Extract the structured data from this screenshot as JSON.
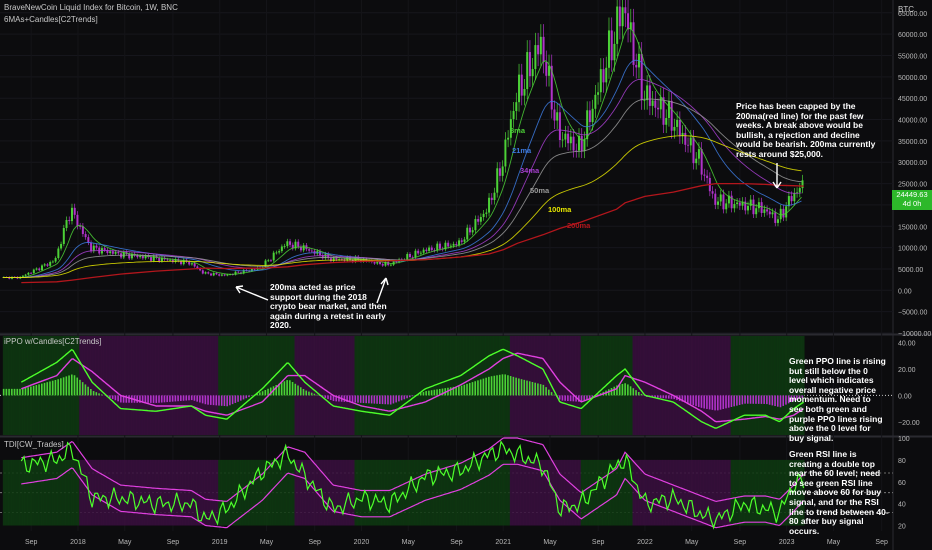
{
  "header": {
    "symbol_line": "BraveNewCoin Liquid Index for Bitcoin, 1W, BNC",
    "indicator_line": "6MAs+Candles[C2Trends]",
    "currency": "BTC"
  },
  "panels": {
    "ppo_title": "iPPO w/Candles[C2Trends]",
    "tdi_title": "TDI[CW_Trades]"
  },
  "price_tag": {
    "value": "24449.63",
    "sub": "4d 0h"
  },
  "annotations": {
    "top_right": "Price has been capped by the 200ma(red line) for the past few weeks.  A break above would be bullish, a rejection and decline would be bearish.  200ma currently rests around $25,000.",
    "support": "200ma acted as price support during the 2018 crypto bear market, and then again during a retest in early 2020.",
    "ppo_note": "Green PPO line is rising but still below the 0 level which indicates overall negative price momentum.  Need to see both green and purple PPO lines rising above the 0 level for buy signal.",
    "tdi_note": "Green RSI line is creating a double top near the 60 level; need to see green RSI line move above 60 for buy signal, and for the RSI line to trend between 40-80 after buy signal occurs."
  },
  "ma_labels": [
    "8ma",
    "21ma",
    "34ma",
    "50ma",
    "100ma",
    "200ma"
  ],
  "colors": {
    "background": "#0c0c0e",
    "bull": "#4cd137",
    "bear": "#b033c9",
    "ma8": "#4cd137",
    "ma21": "#3d7be0",
    "ma34": "#a83fd1",
    "ma50": "#9a9a9a",
    "ma100": "#e6e600",
    "ma200": "#b3161c",
    "rsi": "#4cff2a",
    "signal": "#e040e0"
  },
  "chart_data": {
    "type": "line",
    "x_ticks": [
      "Sep",
      "2018",
      "May",
      "Sep",
      "2019",
      "May",
      "Sep",
      "2020",
      "May",
      "Sep",
      "2021",
      "May",
      "Sep",
      "2022",
      "May",
      "Sep",
      "2023",
      "May",
      "Sep"
    ],
    "price_axis": {
      "ticks": [
        "65000.00",
        "60000.00",
        "55000.00",
        "50000.00",
        "45000.00",
        "40000.00",
        "35000.00",
        "30000.00",
        "25000.00",
        "20000.00",
        "15000.00",
        "10000.00",
        "5000.00",
        "0.00",
        "−5000.00",
        "−10000.00"
      ],
      "ylim": [
        -10000,
        68000
      ]
    },
    "ppo_axis": {
      "ticks": [
        "40.00",
        "20.00",
        "0.00",
        "−20.00"
      ],
      "ylim": [
        -30,
        45
      ]
    },
    "tdi_axis": {
      "ticks": [
        "100",
        "80",
        "60",
        "40",
        "20"
      ],
      "ylim": [
        15,
        100
      ]
    },
    "dates": [
      2017.6,
      2017.85,
      2017.96,
      2018.1,
      2018.3,
      2018.55,
      2018.8,
      2018.9,
      2019.05,
      2019.3,
      2019.48,
      2019.6,
      2019.8,
      2020.0,
      2020.2,
      2020.45,
      2020.7,
      2020.9,
      2021.0,
      2021.1,
      2021.28,
      2021.4,
      2021.55,
      2021.8,
      2021.86,
      2022.0,
      2022.2,
      2022.4,
      2022.5,
      2022.7,
      2022.85,
      2022.95,
      2023.05,
      2023.12
    ],
    "price": [
      3000,
      7000,
      19000,
      10000,
      8500,
      7500,
      6500,
      4000,
      3500,
      5300,
      11000,
      10000,
      7300,
      7200,
      6000,
      9300,
      11000,
      19000,
      29000,
      45000,
      58000,
      37000,
      33000,
      60000,
      67000,
      46000,
      40000,
      30000,
      21000,
      20000,
      19000,
      16500,
      22000,
      24449
    ],
    "ma200": [
      1800,
      2000,
      2400,
      3000,
      3800,
      4500,
      5000,
      5200,
      5100,
      5200,
      5500,
      6000,
      6500,
      6800,
      6900,
      7200,
      7800,
      8500,
      9500,
      11000,
      13000,
      14500,
      16000,
      19000,
      20500,
      22000,
      23000,
      24500,
      25000,
      25000,
      24800,
      24600,
      24500,
      24400
    ],
    "ppo_green": [
      10,
      25,
      35,
      10,
      -10,
      -12,
      -8,
      -15,
      -18,
      5,
      25,
      10,
      -8,
      -12,
      -15,
      5,
      15,
      30,
      35,
      30,
      20,
      -5,
      -10,
      15,
      20,
      0,
      -5,
      -20,
      -25,
      -15,
      -15,
      -20,
      -10,
      -5
    ],
    "ppo_purple": [
      5,
      15,
      28,
      18,
      0,
      -8,
      -8,
      -12,
      -15,
      -5,
      15,
      15,
      0,
      -8,
      -12,
      -5,
      8,
      20,
      28,
      32,
      28,
      10,
      -5,
      5,
      15,
      10,
      0,
      -12,
      -20,
      -18,
      -16,
      -18,
      -15,
      -10
    ],
    "rsi_green": [
      75,
      80,
      90,
      45,
      45,
      40,
      40,
      25,
      35,
      70,
      85,
      65,
      35,
      45,
      40,
      65,
      70,
      85,
      90,
      85,
      75,
      35,
      40,
      75,
      80,
      40,
      45,
      30,
      25,
      40,
      35,
      32,
      58,
      60
    ],
    "rsi_purple": [
      70,
      75,
      85,
      60,
      45,
      42,
      40,
      32,
      30,
      55,
      80,
      75,
      45,
      40,
      40,
      55,
      65,
      78,
      88,
      88,
      82,
      55,
      38,
      60,
      75,
      55,
      45,
      35,
      30,
      35,
      35,
      32,
      45,
      55
    ]
  }
}
